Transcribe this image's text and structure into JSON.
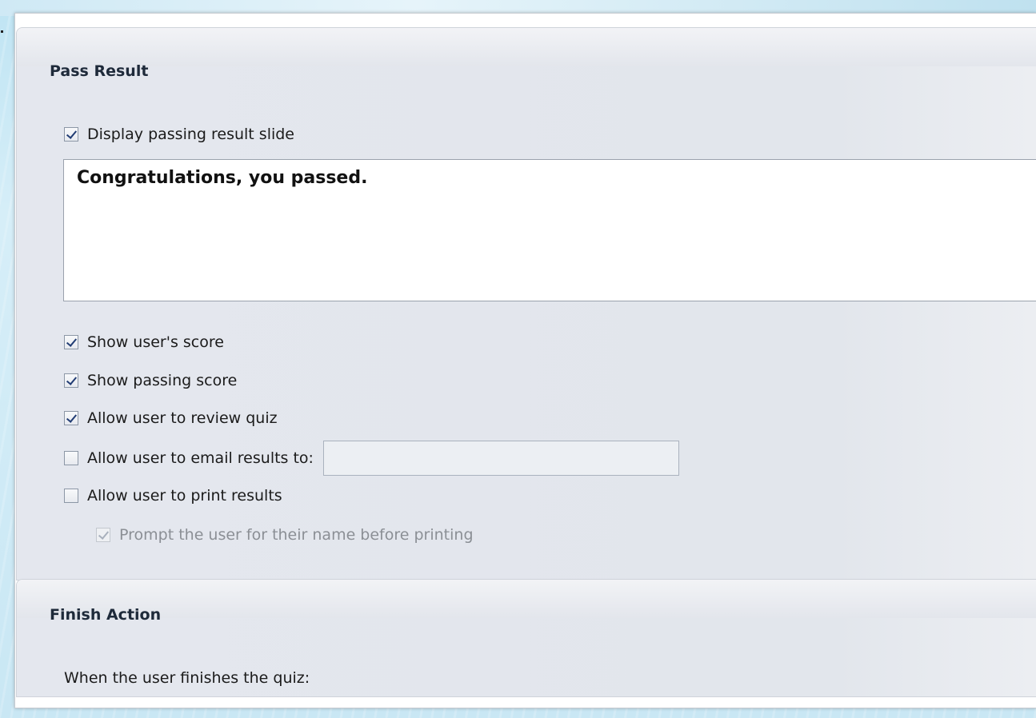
{
  "pass_result": {
    "title": "Pass Result",
    "display_slide": {
      "label": "Display passing result slide",
      "checked": true
    },
    "message": "Congratulations, you passed.",
    "options": [
      {
        "label": "Show user's score",
        "checked": true
      },
      {
        "label": "Show passing score",
        "checked": true
      },
      {
        "label": "Allow user to review quiz",
        "checked": true
      },
      {
        "label": "Allow user to email results to:",
        "checked": false
      },
      {
        "label": "Allow user to print results",
        "checked": false
      },
      {
        "label": "Prompt the user for their name before printing",
        "checked": true,
        "disabled": true
      }
    ],
    "email_value": ""
  },
  "finish_action": {
    "title": "Finish Action",
    "text": "When the user finishes the quiz:"
  }
}
